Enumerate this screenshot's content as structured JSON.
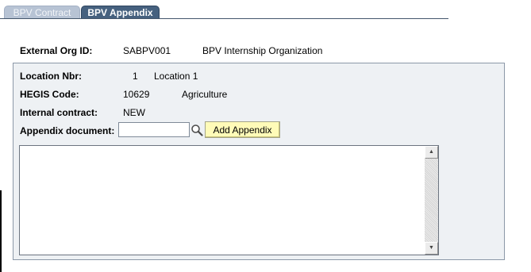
{
  "tabs": [
    {
      "label": "BPV Contract",
      "active": false
    },
    {
      "label": "BPV Appendix",
      "active": true
    }
  ],
  "header": {
    "org_id_label": "External Org ID:",
    "org_id_value": "SABPV001",
    "org_name": "BPV Internship Organization"
  },
  "details": {
    "location_label": "Location Nbr:",
    "location_nbr": "1",
    "location_name": "Location 1",
    "hegis_label": "HEGIS Code:",
    "hegis_code": "10629",
    "hegis_name": "Agriculture",
    "internal_contract_label": "Internal contract:",
    "internal_contract_value": "NEW",
    "appendix_label": "Appendix document:",
    "appendix_value": "",
    "add_appendix_label": "Add Appendix",
    "lookup_icon": "magnifier-lookup-icon",
    "notes_text": ""
  },
  "colors": {
    "active_tab": "#46617f",
    "inactive_tab": "#b7c3d4",
    "group_background": "#eef1f4",
    "button_background": "#fffbb8"
  }
}
